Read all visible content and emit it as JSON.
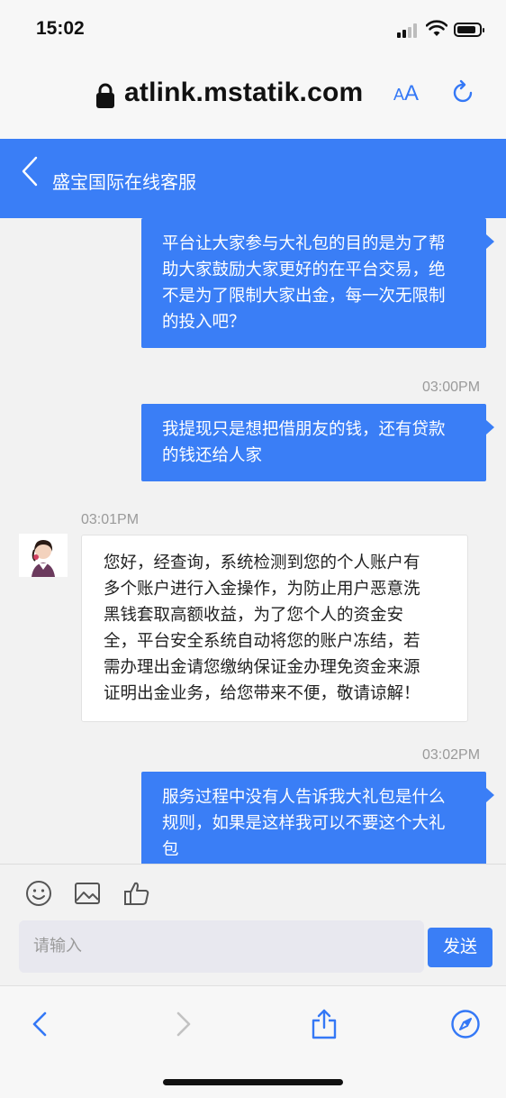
{
  "status_bar": {
    "time": "15:02",
    "icons": [
      "signal-icon",
      "wifi-icon",
      "battery-icon"
    ],
    "battery_level": 0.85
  },
  "browser": {
    "url": "atlink.mstatik.com",
    "text_size_label_small": "A",
    "text_size_label_large": "A",
    "accent_color": "#3478f6"
  },
  "header": {
    "title": "盛宝国际在线客服",
    "color": "#3a7ef6"
  },
  "messages": [
    {
      "from": "user",
      "text": "平台让大家参与大礼包的目的是为了帮助大家鼓励大家更好的在平台交易，绝不是为了限制大家出金，每一次无限制的投入吧？",
      "lines": [
        "平台让大家参与大礼包的目的是为了帮",
        "助大家鼓励大家更好的在平台交易，绝",
        "不是为了限制大家出金，每一次无限制",
        "的投入吧？"
      ]
    },
    {
      "from": "user",
      "time": "03:00PM",
      "lines": [
        "我提现只是想把借朋友的钱，还有贷款",
        "的钱还给人家"
      ]
    },
    {
      "from": "agent",
      "time": "03:01PM",
      "lines": [
        "您好，经查询，系统检测到您的个人账户有",
        "多个账户进行入金操作，为防止用户恶意洗",
        "黑钱套取高额收益，为了您个人的资金安",
        "全，平台安全系统自动将您的账户冻结，若",
        "需办理出金请您缴纳保证金办理免资金来源",
        "证明出金业务，给您带来不便，敬请谅解！"
      ]
    },
    {
      "from": "user",
      "time": "03:02PM",
      "lines": [
        "服务过程中没有人告诉我大礼包是什么",
        "规则，如果是这样我可以不要这个大礼",
        "包"
      ]
    }
  ],
  "composer": {
    "tools": [
      "emoji-icon",
      "image-icon",
      "thumbs-up-icon"
    ],
    "input_placeholder": "请输入",
    "send_label": "发送"
  },
  "toolbar": {
    "icons": [
      "back-icon",
      "forward-icon",
      "share-icon",
      "compass-icon"
    ]
  }
}
